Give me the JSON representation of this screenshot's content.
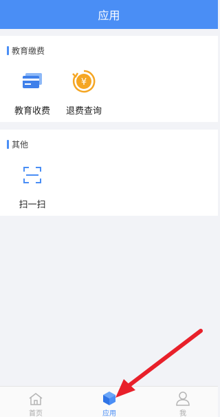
{
  "header": {
    "title": "应用"
  },
  "sections": [
    {
      "title": "教育缴费",
      "apps": [
        {
          "label": "教育收费",
          "icon": "card-icon"
        },
        {
          "label": "退费查询",
          "icon": "yuan-refund-icon"
        }
      ]
    },
    {
      "title": "其他",
      "apps": [
        {
          "label": "扫一扫",
          "icon": "scan-icon"
        }
      ]
    }
  ],
  "tabbar": {
    "tabs": [
      {
        "label": "首页",
        "icon": "home-icon",
        "active": false
      },
      {
        "label": "应用",
        "icon": "cube-icon",
        "active": true
      },
      {
        "label": "我",
        "icon": "user-icon",
        "active": false
      }
    ]
  },
  "colors": {
    "accent": "#4a8ef5",
    "refund_orange": "#f5a623",
    "annotation_arrow": "#e8202a"
  }
}
